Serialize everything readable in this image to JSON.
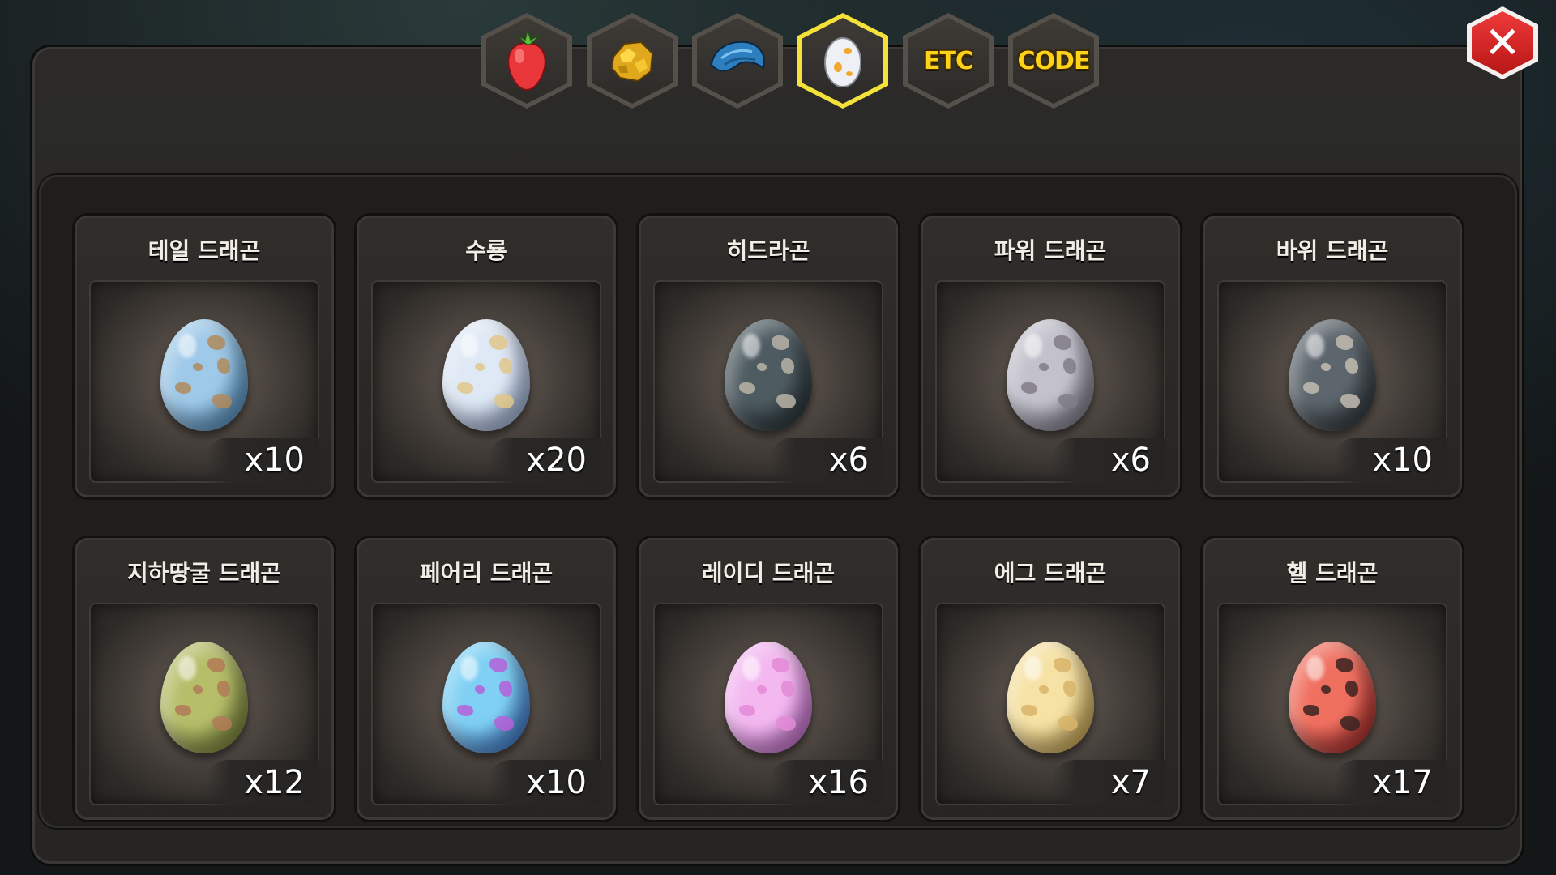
{
  "tabs": [
    {
      "name": "fruit-tab",
      "icon": "strawberry-icon",
      "active": false
    },
    {
      "name": "ore-tab",
      "icon": "gold-ore-icon",
      "active": false
    },
    {
      "name": "scale-tab",
      "icon": "dragon-scale-icon",
      "active": false
    },
    {
      "name": "egg-tab",
      "icon": "dragon-egg-icon",
      "active": true
    },
    {
      "name": "etc-tab",
      "label": "ETC",
      "active": false
    },
    {
      "name": "code-tab",
      "label": "CODE",
      "active": false
    }
  ],
  "close_button": {
    "icon": "close-icon"
  },
  "eggs": [
    {
      "name": "테일 드래곤",
      "count": "x10",
      "color": "#9ec9e8",
      "color2": "#3f86c2",
      "spot": "#b08a5c"
    },
    {
      "name": "수룡",
      "count": "x20",
      "color": "#dfe8f5",
      "color2": "#8ea8d8",
      "spot": "#e0c78a"
    },
    {
      "name": "히드라곤",
      "count": "x6",
      "color": "#4e5c62",
      "color2": "#1f2a2e",
      "spot": "#b9b3a7"
    },
    {
      "name": "파워 드래곤",
      "count": "x6",
      "color": "#c3c1cc",
      "color2": "#6f6c7c",
      "spot": "#807c88"
    },
    {
      "name": "바위 드래곤",
      "count": "x10",
      "color": "#5d666d",
      "color2": "#252b30",
      "spot": "#c2bcb2"
    },
    {
      "name": "지하땅굴 드래곤",
      "count": "x12",
      "color": "#b6be6a",
      "color2": "#6d7a2c",
      "spot": "#b17a56"
    },
    {
      "name": "페어리 드래곤",
      "count": "x10",
      "color": "#7fd0f4",
      "color2": "#2a5fcf",
      "spot": "#b560d8"
    },
    {
      "name": "레이디 드래곤",
      "count": "x16",
      "color": "#f3b8f0",
      "color2": "#c35ad0",
      "spot": "#e48ad8"
    },
    {
      "name": "에그 드래곤",
      "count": "x7",
      "color": "#f6e2a4",
      "color2": "#c99c3a",
      "spot": "#d8b46a"
    },
    {
      "name": "헬 드래곤",
      "count": "x17",
      "color": "#f07060",
      "color2": "#a0161a",
      "spot": "#3a2220"
    }
  ]
}
